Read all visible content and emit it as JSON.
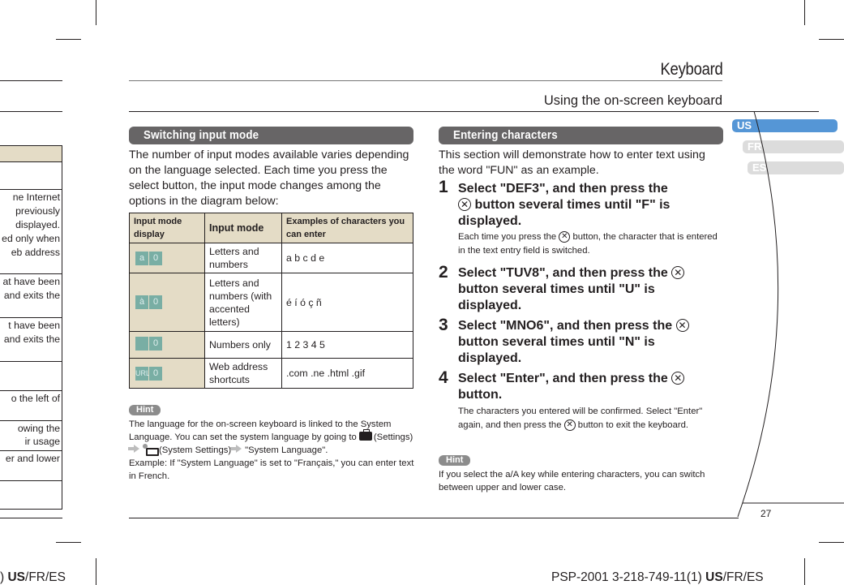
{
  "left_page": {
    "lines": [
      "ne Internet",
      "previously",
      "displayed.",
      "ed only when",
      "eb address",
      "at have been",
      "and exits the",
      "t have been",
      "and exits the",
      "o the left of",
      "owing the",
      "ir usage",
      "er and lower"
    ],
    "footer": {
      "prefix": ") ",
      "bold": "US",
      "rest": "/FR/ES"
    }
  },
  "header": {
    "title": "Keyboard",
    "subtitle": "Using the on-screen keyboard"
  },
  "language_tabs": [
    {
      "label": "US",
      "active": true,
      "color": "#5596d6"
    },
    {
      "label": "FR",
      "active": false,
      "color": "#dcdcdc"
    },
    {
      "label": "ES",
      "active": false,
      "color": "#dcdcdc"
    }
  ],
  "switching": {
    "heading": "Switching input mode",
    "intro": "The number of input modes available varies depending on the language selected. Each time you press the select button, the input mode changes among the options in the diagram below:",
    "table": {
      "headers": [
        "Input mode display",
        "Input mode",
        "Examples of characters you can enter"
      ],
      "rows": [
        {
          "icon_left": "a",
          "icon_right": "0",
          "mode": "Letters and numbers",
          "examples": "a b c d e"
        },
        {
          "icon_left": "à",
          "icon_right": "0",
          "mode": "Letters and numbers (with accented letters)",
          "examples": "é í ó ç ñ"
        },
        {
          "icon_left": "",
          "icon_right": "0",
          "mode": "Numbers only",
          "examples": "1 2 3 4 5"
        },
        {
          "icon_left": "URL",
          "icon_right": "0",
          "mode": "Web address shortcuts",
          "examples": ".com .ne .html .gif"
        }
      ]
    },
    "hint_label": "Hint",
    "hint_line1": "The language for the on-screen keyboard is linked to the System Language. You can set the system language by going to",
    "hint_settings": "(Settings)",
    "hint_system_settings": "(System Settings)",
    "hint_system_language": "\"System Language\".",
    "hint_example": "Example:  If \"System Language\" is set to \"Français,\" you can enter text in French."
  },
  "entering": {
    "heading": "Entering characters",
    "intro": "This section will demonstrate how to enter text using the word \"FUN\" as an example.",
    "steps": [
      {
        "num": "1",
        "pre": "Select \"DEF3\", and then press the",
        "post": "button several times until \"F\" is displayed.",
        "note_pre": "Each time you press the",
        "note_post": "button, the character that is entered in the text entry field is switched."
      },
      {
        "num": "2",
        "pre": "Select \"TUV8\", and then press the",
        "post": "button several times until \"U\" is displayed."
      },
      {
        "num": "3",
        "pre": "Select \"MNO6\", and then press the",
        "post": "button several times until \"N\" is displayed."
      },
      {
        "num": "4",
        "pre": "Select \"Enter\", and then press the",
        "post": "button.",
        "note_pre": "The characters you entered will be confirmed. Select \"Enter\" again, and then press the",
        "note_post": "button to exit the keyboard."
      }
    ],
    "cross_symbol": "✕",
    "hint_label": "Hint",
    "hint_text": "If you select the a/A key while entering characters, you can switch between upper and lower case."
  },
  "page_number": "27",
  "footer": {
    "model": "PSP-2001 3-218-749-11(1) ",
    "bold": "US",
    "rest": "/FR/ES"
  }
}
